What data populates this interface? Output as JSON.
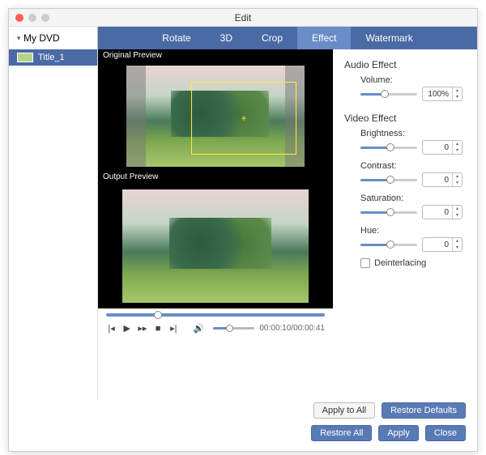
{
  "window": {
    "title": "Edit"
  },
  "sidebar": {
    "disc_label": "My DVD",
    "items": [
      {
        "label": "Title_1"
      }
    ]
  },
  "tabs": [
    {
      "label": "Rotate",
      "active": false
    },
    {
      "label": "3D",
      "active": false
    },
    {
      "label": "Crop",
      "active": false
    },
    {
      "label": "Effect",
      "active": true
    },
    {
      "label": "Watermark",
      "active": false
    }
  ],
  "preview": {
    "original_label": "Original Preview",
    "output_label": "Output Preview",
    "timecode": "00:00:10/00:00:41"
  },
  "audio_effect": {
    "title": "Audio Effect",
    "volume": {
      "label": "Volume:",
      "value": "100%",
      "fill_pct": 38
    }
  },
  "video_effect": {
    "title": "Video Effect",
    "brightness": {
      "label": "Brightness:",
      "value": "0",
      "fill_pct": 48
    },
    "contrast": {
      "label": "Contrast:",
      "value": "0",
      "fill_pct": 48
    },
    "saturation": {
      "label": "Saturation:",
      "value": "0",
      "fill_pct": 48
    },
    "hue": {
      "label": "Hue:",
      "value": "0",
      "fill_pct": 48
    },
    "deinterlacing": {
      "label": "Deinterlacing",
      "checked": false
    }
  },
  "buttons": {
    "apply_all": "Apply to All",
    "restore_defaults": "Restore Defaults",
    "restore_all": "Restore All",
    "apply": "Apply",
    "close": "Close"
  }
}
